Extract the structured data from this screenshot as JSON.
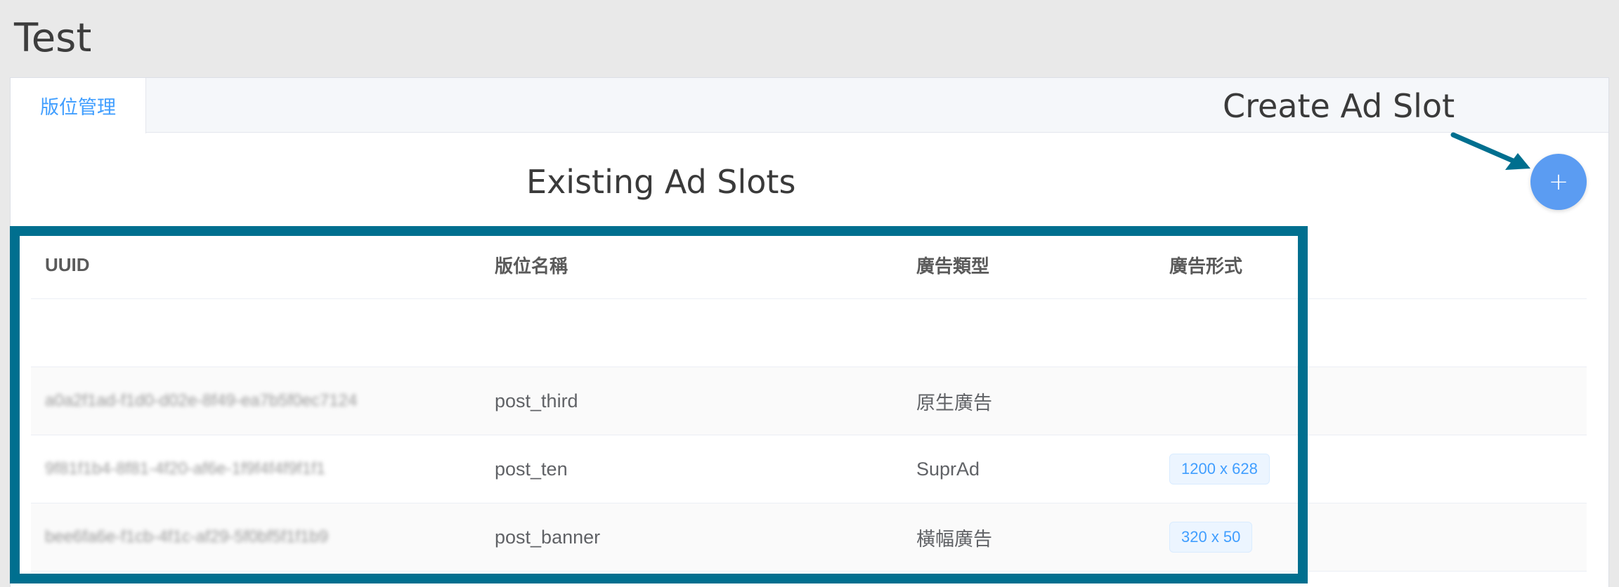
{
  "app": {
    "title": "Test"
  },
  "tabs": [
    {
      "label": "版位管理",
      "active": true
    }
  ],
  "annotations": {
    "create_label": "Create Ad Slot",
    "existing_label": "Existing Ad Slots",
    "highlight_color": "#006f8f"
  },
  "add_button": {
    "icon": "plus-icon",
    "glyph": "+",
    "color": "#5b9cf2"
  },
  "table": {
    "columns": [
      "UUID",
      "版位名稱",
      "廣告類型",
      "廣告形式"
    ],
    "rows": [
      {
        "uuid": "",
        "name": "",
        "type": "",
        "format": ""
      },
      {
        "uuid": "a0a2f1ad-f1d0-d02e-8f49-ea7b5f0ec7124",
        "name": "post_third",
        "type": "原生廣告",
        "format": ""
      },
      {
        "uuid": "9f81f1b4-8f81-4f20-af6e-1f9f4f4f9f1f1",
        "name": "post_ten",
        "type": "SuprAd",
        "format": "1200 x 628"
      },
      {
        "uuid": "bee6fa6e-f1cb-4f1c-af29-5f0bf5f1f1b9",
        "name": "post_banner",
        "type": "橫幅廣告",
        "format": "320 x 50"
      }
    ]
  },
  "colors": {
    "accent": "#409eff",
    "tab_text": "#409eff"
  }
}
